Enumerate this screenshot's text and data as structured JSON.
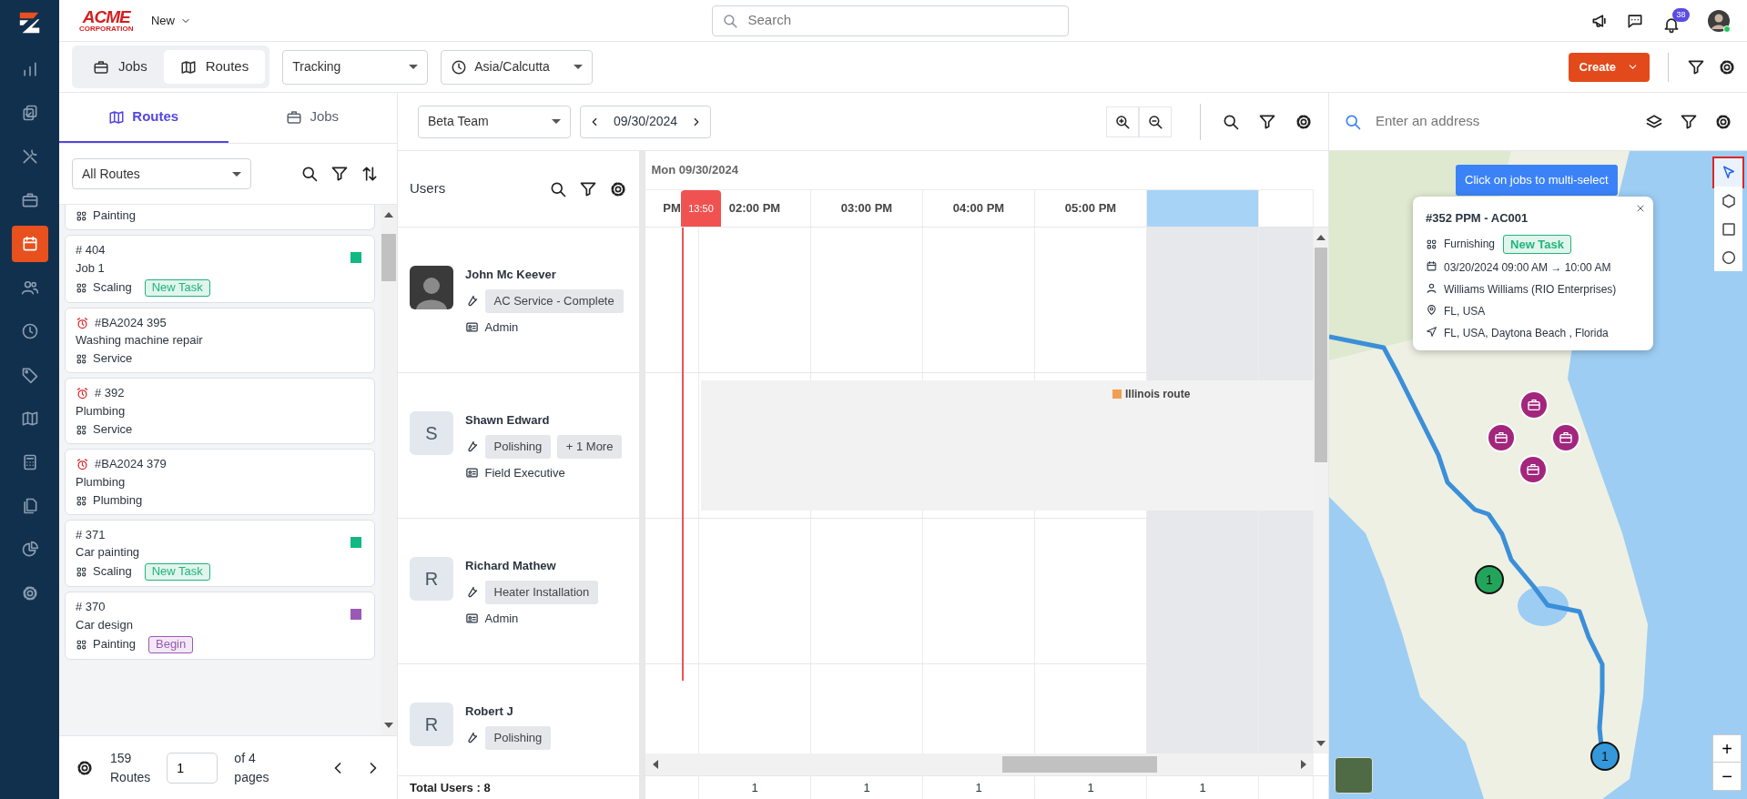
{
  "brand": {
    "name": "ACME",
    "tagline": "CORPORATION"
  },
  "new_menu": {
    "label": "New"
  },
  "search": {
    "placeholder": "Search"
  },
  "notifications": {
    "count": "38"
  },
  "sidebar": {
    "items": [
      {
        "selected": false
      },
      {
        "selected": false
      },
      {
        "selected": false
      },
      {
        "selected": false
      },
      {
        "selected": true
      },
      {
        "selected": false
      },
      {
        "selected": false
      },
      {
        "selected": false
      },
      {
        "selected": false
      },
      {
        "selected": false
      },
      {
        "selected": false
      },
      {
        "selected": false
      },
      {
        "selected": false
      }
    ]
  },
  "view_tabs": [
    {
      "label": "Jobs",
      "selected": false
    },
    {
      "label": "Routes",
      "selected": true
    }
  ],
  "tracking": {
    "value": "Tracking"
  },
  "timezone": {
    "value": "Asia/Calcutta"
  },
  "create_button": {
    "label": "Create"
  },
  "left_panel": {
    "tabs": [
      {
        "label": "Routes",
        "selected": true
      },
      {
        "label": "Jobs",
        "selected": false
      }
    ],
    "filter": {
      "value": "All Routes"
    },
    "jobs": [
      {
        "category": "Painting"
      },
      {
        "number": "# 404",
        "title": "Job 1",
        "category": "Scaling",
        "badge": {
          "label": "New Task",
          "color": "#1fb57a"
        },
        "color": "#10b981",
        "overdue": false
      },
      {
        "number": "#BA2024 395",
        "title": "Washing machine repair",
        "category": "Service",
        "overdue": true
      },
      {
        "number": "# 392",
        "title": "Plumbing",
        "category": "Service",
        "overdue": true
      },
      {
        "number": "#BA2024 379",
        "title": "Plumbing",
        "category": "Plumbing",
        "overdue": true
      },
      {
        "number": "# 371",
        "title": "Car painting",
        "category": "Scaling",
        "badge": {
          "label": "New Task",
          "color": "#1fb57a"
        },
        "color": "#10b981",
        "overdue": false
      },
      {
        "number": "# 370",
        "title": "Car design",
        "category": "Painting",
        "badge": {
          "label": "Begin",
          "color": "#9b59b6"
        },
        "color": "#9b59b6",
        "overdue": false
      }
    ],
    "footer": {
      "count": "159",
      "unit": "Routes",
      "page": "1",
      "of": "of 4",
      "pages": "pages"
    }
  },
  "scheduler": {
    "team": "Beta Team",
    "date": "09/30/2024",
    "users_title": "Users",
    "day": "Mon 09/30/2024",
    "now": "13:50",
    "columns": [
      {
        "label": "PM",
        "highlighted": false,
        "shaded": false
      },
      {
        "label": "02:00 PM",
        "highlighted": false,
        "shaded": false,
        "count": "1"
      },
      {
        "label": "03:00 PM",
        "highlighted": false,
        "shaded": false,
        "count": "1"
      },
      {
        "label": "04:00 PM",
        "highlighted": false,
        "shaded": false,
        "count": "1"
      },
      {
        "label": "05:00 PM",
        "highlighted": false,
        "shaded": false,
        "count": "1"
      },
      {
        "highlighted": true,
        "shaded": true,
        "count": "1"
      },
      {
        "highlighted": false,
        "shaded": true
      }
    ],
    "users": [
      {
        "name": "John Mc Keever",
        "kind": "photo",
        "skills": [
          "AC Service - Complete"
        ],
        "role": "Admin"
      },
      {
        "name": "Shawn Edward",
        "kind": "initial",
        "initial": "S",
        "skills": [
          "Polishing",
          "+ 1 More"
        ],
        "role": "Field Executive",
        "events": [
          {
            "label": "Illinois route",
            "color": "#f0a050"
          }
        ]
      },
      {
        "name": "Richard Mathew",
        "kind": "initial",
        "initial": "R",
        "skills": [
          "Heater Installation"
        ],
        "role": "Admin"
      },
      {
        "name": "Robert J",
        "kind": "initial",
        "initial": "R",
        "skills": [
          "Polishing"
        ]
      }
    ],
    "total": "Total Users : 8"
  },
  "map": {
    "placeholder": "Enter an address",
    "hint": "Click on jobs to multi-select",
    "tools": [
      {
        "selected": true
      },
      {
        "selected": false
      },
      {
        "selected": false
      },
      {
        "selected": false
      }
    ],
    "popup": {
      "title": "#352 PPM - AC001",
      "category": "Furnishing",
      "badge": {
        "label": "New Task",
        "color": "#1fb57a"
      },
      "time": "03/20/2024 09:00 AM → 10:00 AM",
      "customer": "Williams Williams (RIO Enterprises)",
      "location": "FL, USA",
      "address": "FL, USA, Daytona Beach , Florida"
    },
    "clusters": [
      {
        "label": "1",
        "color": "#22a55a"
      },
      {
        "label": "1",
        "color": "#3498db"
      }
    ],
    "zoom": [
      "+",
      "−"
    ]
  }
}
